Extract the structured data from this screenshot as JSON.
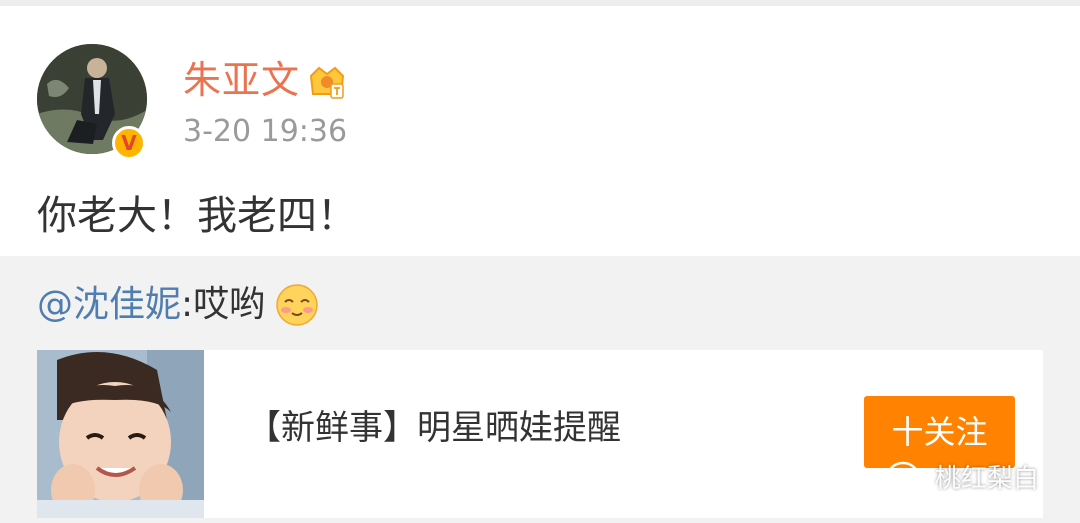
{
  "post": {
    "author": "朱亚文",
    "verified_mark": "V",
    "timestamp": "3-20 19:36",
    "text": "你老大！我老四！"
  },
  "repost": {
    "mention": "@沈佳妮",
    "text": ":哎哟"
  },
  "card": {
    "title": "【新鲜事】明星晒娃提醒",
    "follow_label": "十关注"
  },
  "watermark": {
    "text": "桃红梨白"
  },
  "colors": {
    "name_orange": "#eb7350",
    "mention_blue": "#507daf",
    "follow_orange": "#ff8200",
    "repost_background": "#f2f2f2"
  },
  "icons": {
    "level_badge": "crown-icon",
    "verified": "verified-icon",
    "emoji": "shy-smile-emoji",
    "watermark": "wechat-icon"
  }
}
